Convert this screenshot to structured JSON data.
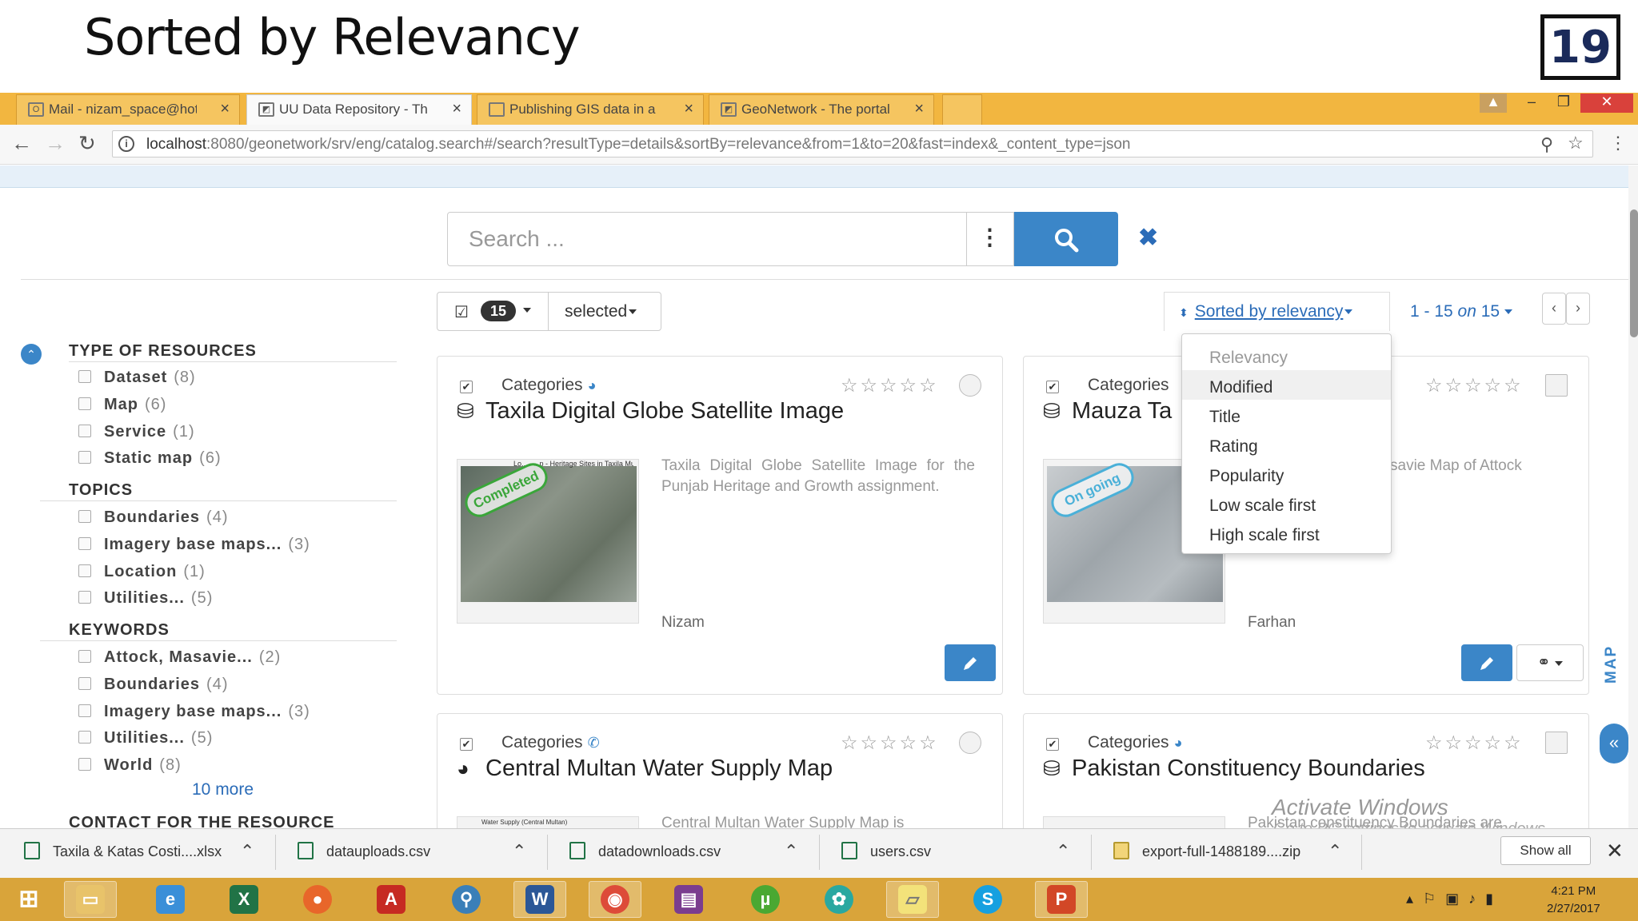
{
  "slide": {
    "title": "Sorted by Relevancy",
    "number": "19"
  },
  "browser": {
    "tabs": [
      {
        "label": "Mail - nizam_space@hotr",
        "icon": "outlook-icon"
      },
      {
        "label": "UU Data Repository - The",
        "icon": "geonetwork-icon",
        "active": true
      },
      {
        "label": "Publishing GIS data in a r",
        "icon": "document-icon"
      },
      {
        "label": "GeoNetwork - The portal",
        "icon": "geonetwork-icon"
      }
    ],
    "url_host": "localhost",
    "url_rest": ":8080/geonetwork/srv/eng/catalog.search#/search?resultType=details&sortBy=relevance&from=1&to=20&fast=index&_content_type=json"
  },
  "search": {
    "placeholder": "Search ..."
  },
  "toolbar": {
    "selected_count": "15",
    "selected_label": "selected",
    "sort_label": "Sorted by relevancy",
    "pager_from_to": "1 - 15",
    "pager_on": "on",
    "pager_total": "15"
  },
  "sort_menu": {
    "items": [
      "Relevancy",
      "Modified",
      "Title",
      "Rating",
      "Popularity",
      "Low scale first",
      "High scale first"
    ]
  },
  "facets": {
    "type_of_resources": {
      "title": "TYPE OF RESOURCES",
      "items": [
        {
          "label": "Dataset",
          "count": "(8)"
        },
        {
          "label": "Map",
          "count": "(6)"
        },
        {
          "label": "Service",
          "count": "(1)"
        },
        {
          "label": "Static map",
          "count": "(6)"
        }
      ]
    },
    "topics": {
      "title": "TOPICS",
      "items": [
        {
          "label": "Boundaries",
          "count": "(4)"
        },
        {
          "label": "Imagery base maps...",
          "count": "(3)"
        },
        {
          "label": "Location",
          "count": "(1)"
        },
        {
          "label": "Utilities...",
          "count": "(5)"
        }
      ]
    },
    "keywords": {
      "title": "KEYWORDS",
      "items": [
        {
          "label": "Attock, Masavie...",
          "count": "(2)"
        },
        {
          "label": "Boundaries",
          "count": "(4)"
        },
        {
          "label": "Imagery base maps...",
          "count": "(3)"
        },
        {
          "label": "Utilities...",
          "count": "(5)"
        },
        {
          "label": "World",
          "count": "(8)"
        }
      ]
    },
    "more_link": "10  more",
    "contact_title": "CONTACT FOR THE RESOURCE"
  },
  "cards": [
    {
      "categories": "Categories",
      "title": "Taxila Digital Globe Satellite Image",
      "status": "Completed",
      "status_color": "#3aa63a",
      "thumb_caption": "Lo..... ...p - Heritage Sites in Taxila Mus",
      "desc": "Taxila Digital Globe Satellite Image for the Punjab Heritage and Growth assignment.",
      "author": "Nizam"
    },
    {
      "categories": "Categories",
      "title": "Mauza Ta",
      "status": "On going",
      "status_color": "#4ab0d8",
      "desc": "savie Map of Attock",
      "author": "Farhan"
    },
    {
      "categories": "Categories",
      "title": "Central Multan Water Supply Map",
      "thumb_caption": "Water Supply (Central Multan)",
      "desc": "Central Multan Water Supply Map is"
    },
    {
      "categories": "Categories",
      "title": "Pakistan Constituency Boundaries",
      "desc": "Pakistan constituency Boundaries are"
    }
  ],
  "side_tab": {
    "map_label": "MAP"
  },
  "watermark": {
    "line1": "Activate Windows",
    "line2": "Go to PC settings to activate Windows."
  },
  "downloads": {
    "items": [
      "Taxila & Katas Costi....xlsx",
      "datauploads.csv",
      "datadownloads.csv",
      "users.csv",
      "export-full-1488189....zip"
    ],
    "show_all": "Show all"
  },
  "taskbar": {
    "time": "4:21 PM",
    "date": "2/27/2017"
  },
  "colors": {
    "accent": "#3b86c8",
    "taskbar": "#d9a43a",
    "tabbar": "#f2b640"
  }
}
